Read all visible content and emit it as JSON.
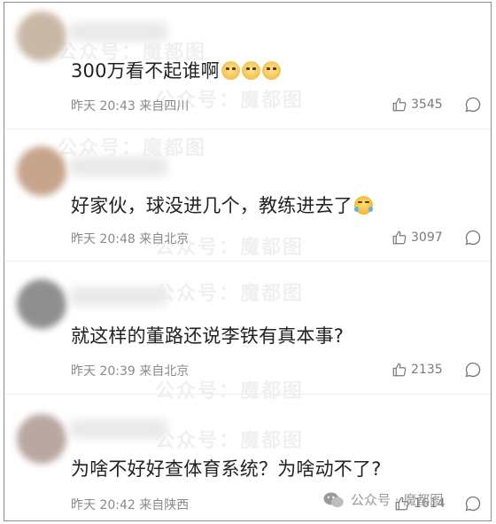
{
  "comments": [
    {
      "text": "300万看不起谁啊",
      "emojis": [
        "dog-face-emoji",
        "dog-face-emoji",
        "dog-face-emoji"
      ],
      "time": "昨天 20:43 来自四川",
      "likes": "3545",
      "avatar_color": "#c9b8a6"
    },
    {
      "text": "好家伙，球没进几个，教练进去了",
      "emojis": [
        "laugh-cry-emoji"
      ],
      "time": "昨天 20:48 来自北京",
      "likes": "3097",
      "avatar_color": "#c7a48c"
    },
    {
      "text": "就这样的董路还说李铁有真本事?",
      "emojis": [],
      "time": "昨天 20:39 来自北京",
      "likes": "2135",
      "avatar_color": "#8f8f8f"
    },
    {
      "text": "为啥不好好查体育系统？为啥动不了?",
      "emojis": [],
      "time": "昨天 20:42 来自陕西",
      "likes": "1614",
      "avatar_color": "#b9a7a0"
    }
  ],
  "watermark": {
    "text": "公众号：魔都图",
    "badge_text": "公众号 · 魔都图"
  }
}
